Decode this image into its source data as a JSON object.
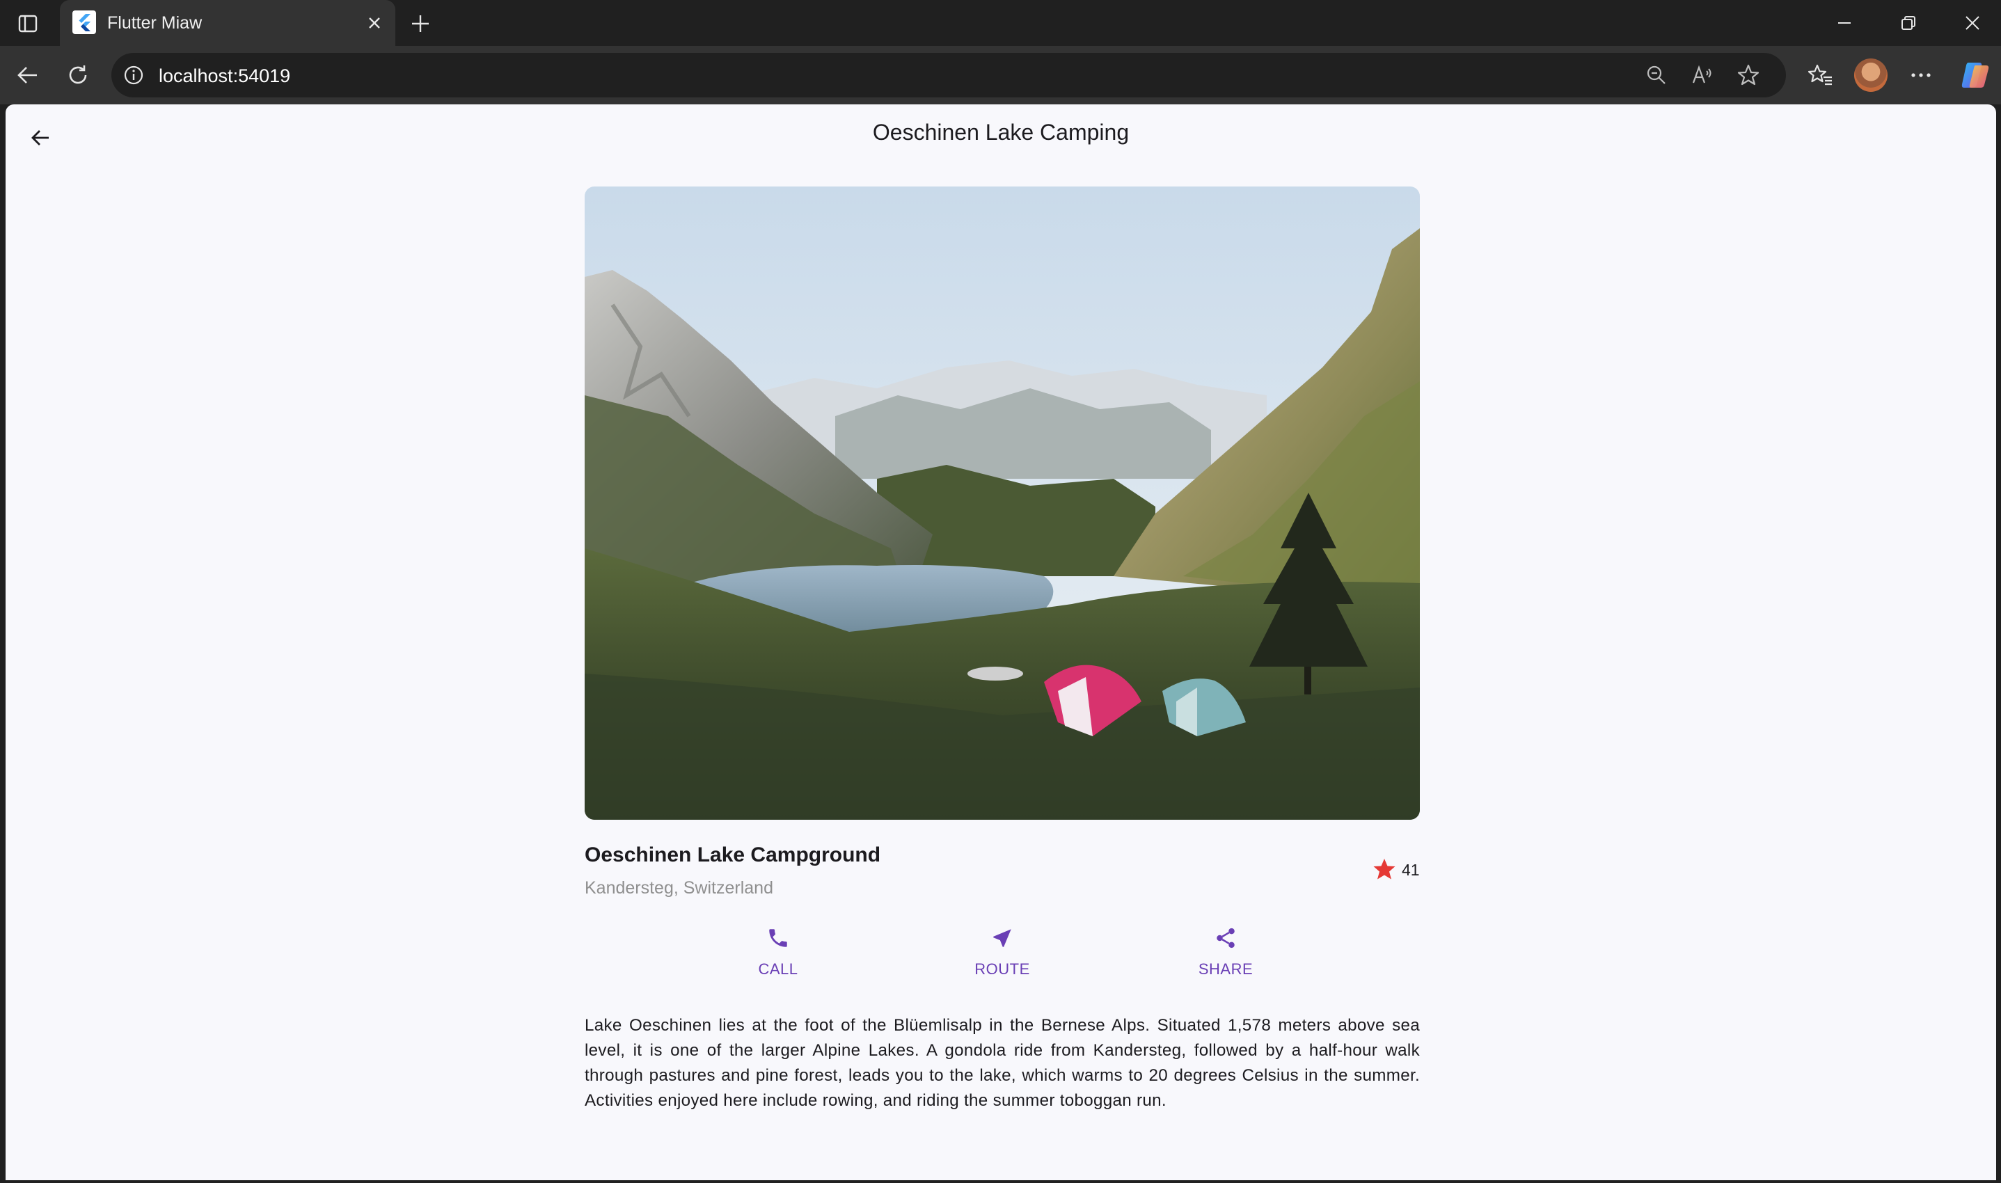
{
  "browser": {
    "tab_title": "Flutter Miaw",
    "url": "localhost:54019"
  },
  "app": {
    "title": "Oeschinen Lake Camping"
  },
  "place": {
    "name": "Oeschinen Lake Campground",
    "location": "Kandersteg, Switzerland",
    "rating_count": "41"
  },
  "actions": [
    {
      "label": "CALL",
      "icon": "phone-icon"
    },
    {
      "label": "ROUTE",
      "icon": "near-me-icon"
    },
    {
      "label": "SHARE",
      "icon": "share-icon"
    }
  ],
  "description": "Lake Oeschinen lies at the foot of the Blüemlisalp in the Bernese Alps. Situated 1,578 meters above sea level, it is one of the larger Alpine Lakes. A gondola ride from Kandersteg, followed by a half-hour walk through pastures and pine forest, leads you to the lake, which warms to 20 degrees Celsius in the summer. Activities enjoyed here include rowing, and riding the summer toboggan run.",
  "colors": {
    "accent": "#6a3fb5",
    "star": "#e53935",
    "page_bg": "#f8f8fc"
  }
}
